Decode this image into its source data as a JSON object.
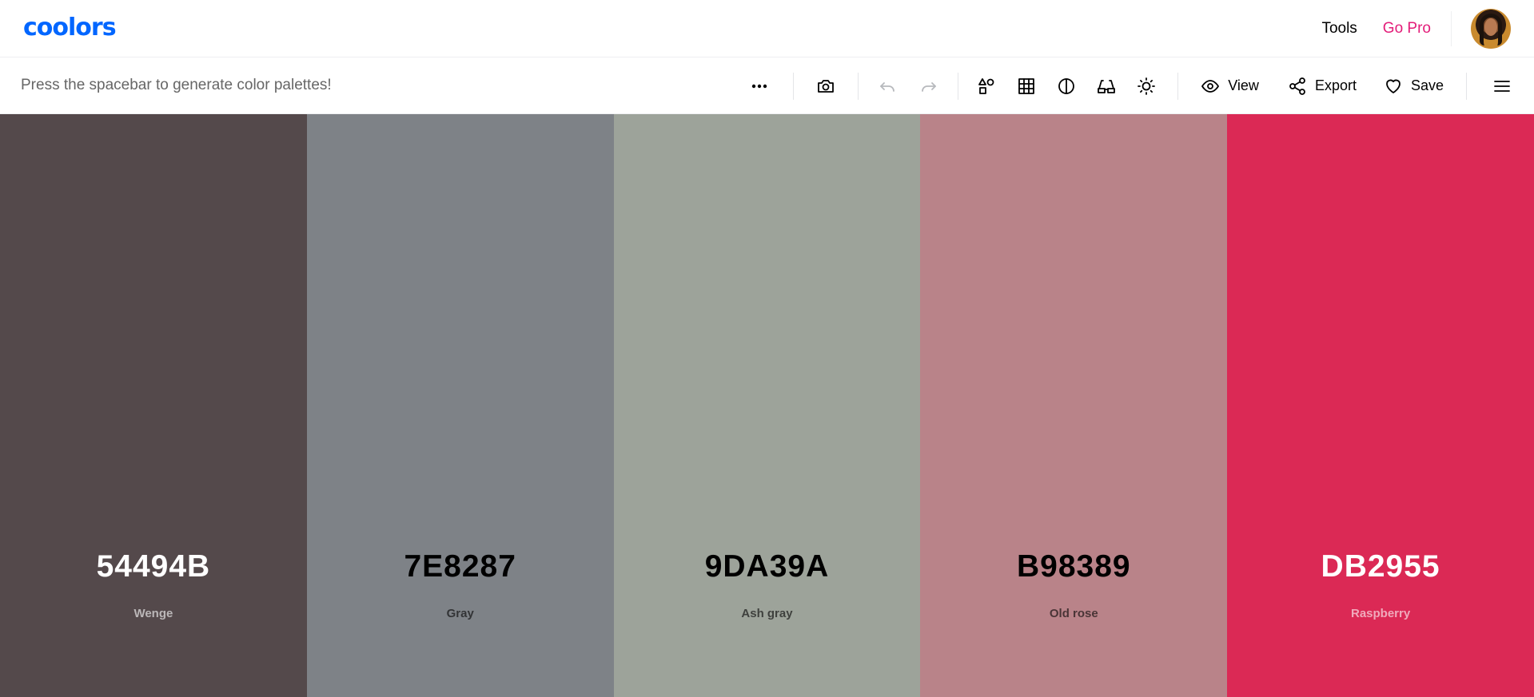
{
  "app": {
    "logo_text": "coolors"
  },
  "nav": {
    "tools_label": "Tools",
    "pro_label": "Go Pro"
  },
  "toolbar": {
    "hint": "Press the spacebar to generate color palettes!",
    "view_label": "View",
    "export_label": "Export",
    "save_label": "Save"
  },
  "icons": {
    "more": "more-dots-icon",
    "camera": "camera-icon",
    "undo": "undo-icon",
    "redo": "redo-icon",
    "shapes": "shapes-icon",
    "grid": "grid-icon",
    "contrast": "contrast-icon",
    "glasses": "color-blindness-glasses-icon",
    "brightness": "sun-icon",
    "view": "eye-icon",
    "export": "share-icon",
    "save": "heart-icon",
    "menu": "hamburger-menu-icon"
  },
  "palette": [
    {
      "hex": "54494B",
      "name": "Wenge",
      "bg": "#54494B",
      "fg": "#ffffff"
    },
    {
      "hex": "7E8287",
      "name": "Gray",
      "bg": "#7E8287",
      "fg": "#000000"
    },
    {
      "hex": "9DA39A",
      "name": "Ash gray",
      "bg": "#9DA39A",
      "fg": "#000000"
    },
    {
      "hex": "B98389",
      "name": "Old rose",
      "bg": "#B98389",
      "fg": "#000000"
    },
    {
      "hex": "DB2955",
      "name": "Raspberry",
      "bg": "#DB2955",
      "fg": "#ffffff"
    }
  ],
  "colors": {
    "brand": "#0066ff",
    "pro": "#e31c79"
  }
}
